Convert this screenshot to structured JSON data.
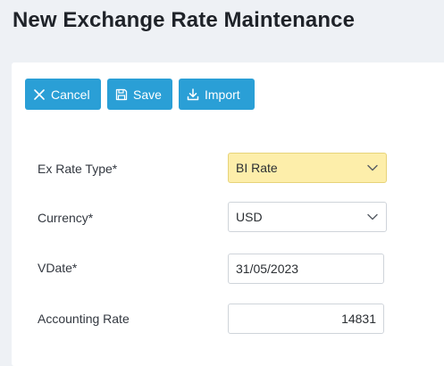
{
  "page": {
    "title": "New Exchange Rate Maintenance"
  },
  "toolbar": {
    "cancel_label": "Cancel",
    "save_label": "Save",
    "import_label": "Import",
    "button_color": "#2a9fd6"
  },
  "form": {
    "ex_rate_type": {
      "label": "Ex Rate Type*",
      "value": "BI Rate",
      "highlight_color": "#fdeeaa"
    },
    "currency": {
      "label": "Currency*",
      "value": "USD"
    },
    "vdate": {
      "label": "VDate*",
      "value": "31/05/2023"
    },
    "accounting_rate": {
      "label": "Accounting Rate",
      "value": "14831"
    }
  },
  "icons": {
    "cancel": "close-icon",
    "save": "save-icon",
    "import": "download-icon",
    "dropdown": "chevron-down-icon"
  }
}
